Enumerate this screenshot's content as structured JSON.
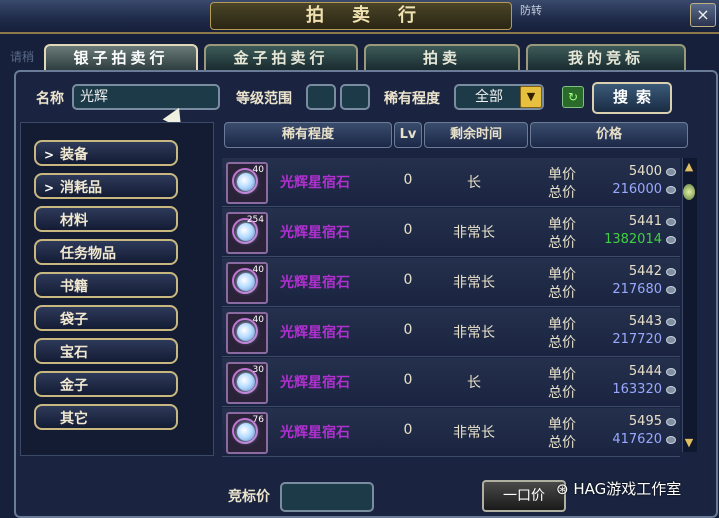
{
  "window": {
    "title": "拍卖行",
    "title_right": "防转",
    "close_label": "×",
    "bg_ghost_text": "请稍"
  },
  "tabs": [
    {
      "label": "银子拍卖行",
      "active": true
    },
    {
      "label": "金子拍卖行",
      "active": false
    },
    {
      "label": "拍卖",
      "active": false
    },
    {
      "label": "我的竞标",
      "active": false
    }
  ],
  "search": {
    "name_label": "名称",
    "name_value": "光辉",
    "level_label": "等级范围",
    "level_min": "",
    "level_max": "",
    "rarity_label": "稀有程度",
    "rarity_value": "全部",
    "search_label": "搜索"
  },
  "categories": [
    {
      "label": "装备",
      "expandable": true
    },
    {
      "label": "消耗品",
      "expandable": true
    },
    {
      "label": "材料",
      "expandable": false
    },
    {
      "label": "任务物品",
      "expandable": false
    },
    {
      "label": "书籍",
      "expandable": false
    },
    {
      "label": "袋子",
      "expandable": false
    },
    {
      "label": "宝石",
      "expandable": false
    },
    {
      "label": "金子",
      "expandable": false
    },
    {
      "label": "其它",
      "expandable": false
    }
  ],
  "table": {
    "headers": {
      "rarity": "稀有程度",
      "lv": "Lv",
      "time": "剩余时间",
      "price": "价格"
    },
    "unit_label": "单价",
    "total_label": "总价",
    "rows": [
      {
        "stack": "40",
        "name": "光辉星宿石",
        "lv": "0",
        "time": "长",
        "unit": "5400",
        "total": "216000",
        "total_color": "#9aa8ff"
      },
      {
        "stack": "254",
        "name": "光辉星宿石",
        "lv": "0",
        "time": "非常长",
        "unit": "5441",
        "total": "1382014",
        "total_color": "#40d040"
      },
      {
        "stack": "40",
        "name": "光辉星宿石",
        "lv": "0",
        "time": "非常长",
        "unit": "5442",
        "total": "217680",
        "total_color": "#9aa8ff"
      },
      {
        "stack": "40",
        "name": "光辉星宿石",
        "lv": "0",
        "time": "非常长",
        "unit": "5443",
        "total": "217720",
        "total_color": "#9aa8ff"
      },
      {
        "stack": "30",
        "name": "光辉星宿石",
        "lv": "0",
        "time": "长",
        "unit": "5444",
        "total": "163320",
        "total_color": "#9aa8ff"
      },
      {
        "stack": "76",
        "name": "光辉星宿石",
        "lv": "0",
        "time": "非常长",
        "unit": "5495",
        "total": "417620",
        "total_color": "#9aa8ff"
      }
    ]
  },
  "bottom": {
    "bid_label": "竞标价",
    "bid_value": "",
    "buyout_label": "一口价",
    "watermark": "HAG游戏工作室"
  }
}
